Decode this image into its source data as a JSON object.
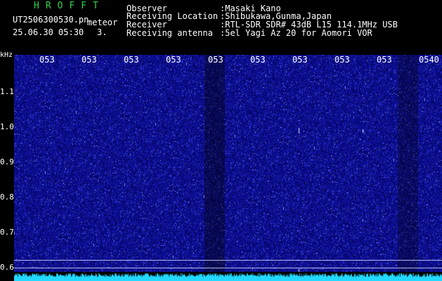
{
  "logo_text": "HROFFT",
  "file_name": "UT2506300530.pn",
  "label_meteor": "meteor",
  "datetime": "25.06.30 05:30",
  "count": "3.",
  "info": [
    {
      "label": "Observer",
      "value": ":Masaki Kano"
    },
    {
      "label": "Receiving Location",
      "value": ":Shibukawa,Gunma,Japan"
    },
    {
      "label": "Receiver",
      "value": ":RTL-SDR SDR# 43dB L15 114.1MHz USB"
    },
    {
      "label": "Receiving antenna",
      "value": ":5el Yagi Az 20 for Aomori VOR"
    }
  ],
  "y_unit": "kHz",
  "y_ticks": [
    "1.1",
    "1.0",
    "0.9",
    "0.8",
    "0.7",
    "0.6"
  ],
  "x_ticks": [
    "053",
    "053",
    "053",
    "053",
    "053",
    "053",
    "053",
    "053",
    "053",
    "0540"
  ],
  "colors": {
    "background": "#000000",
    "waterfall": "#1a1aa0",
    "spectrum": "#22d8ff",
    "logo": "#2fd34a"
  }
}
